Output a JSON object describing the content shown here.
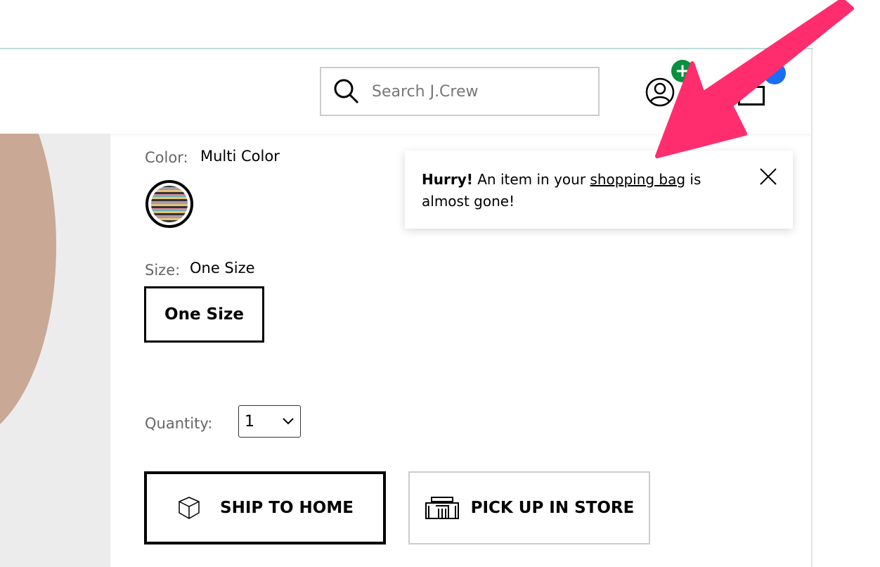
{
  "header": {
    "search_placeholder": "Search J.Crew",
    "account_badge": "+",
    "bag_badge": "",
    "colors": {
      "account_badge": "#0a8f3e",
      "bag_badge": "#1a6ef5"
    }
  },
  "product": {
    "color_label": "Color:",
    "color_value": "Multi Color",
    "size_label": "Size:",
    "size_value": "One Size",
    "size_option": "One Size",
    "quantity_label": "Quantity:",
    "quantity_value": "1",
    "ship_label": "SHIP TO HOME",
    "pickup_label": "PICK UP IN STORE"
  },
  "toast": {
    "bold": "Hurry!",
    "text_before": " An item in your ",
    "link": "shopping bag",
    "text_after": " is almost gone!"
  },
  "annotation": {
    "arrow_color": "#ff2d6e"
  }
}
